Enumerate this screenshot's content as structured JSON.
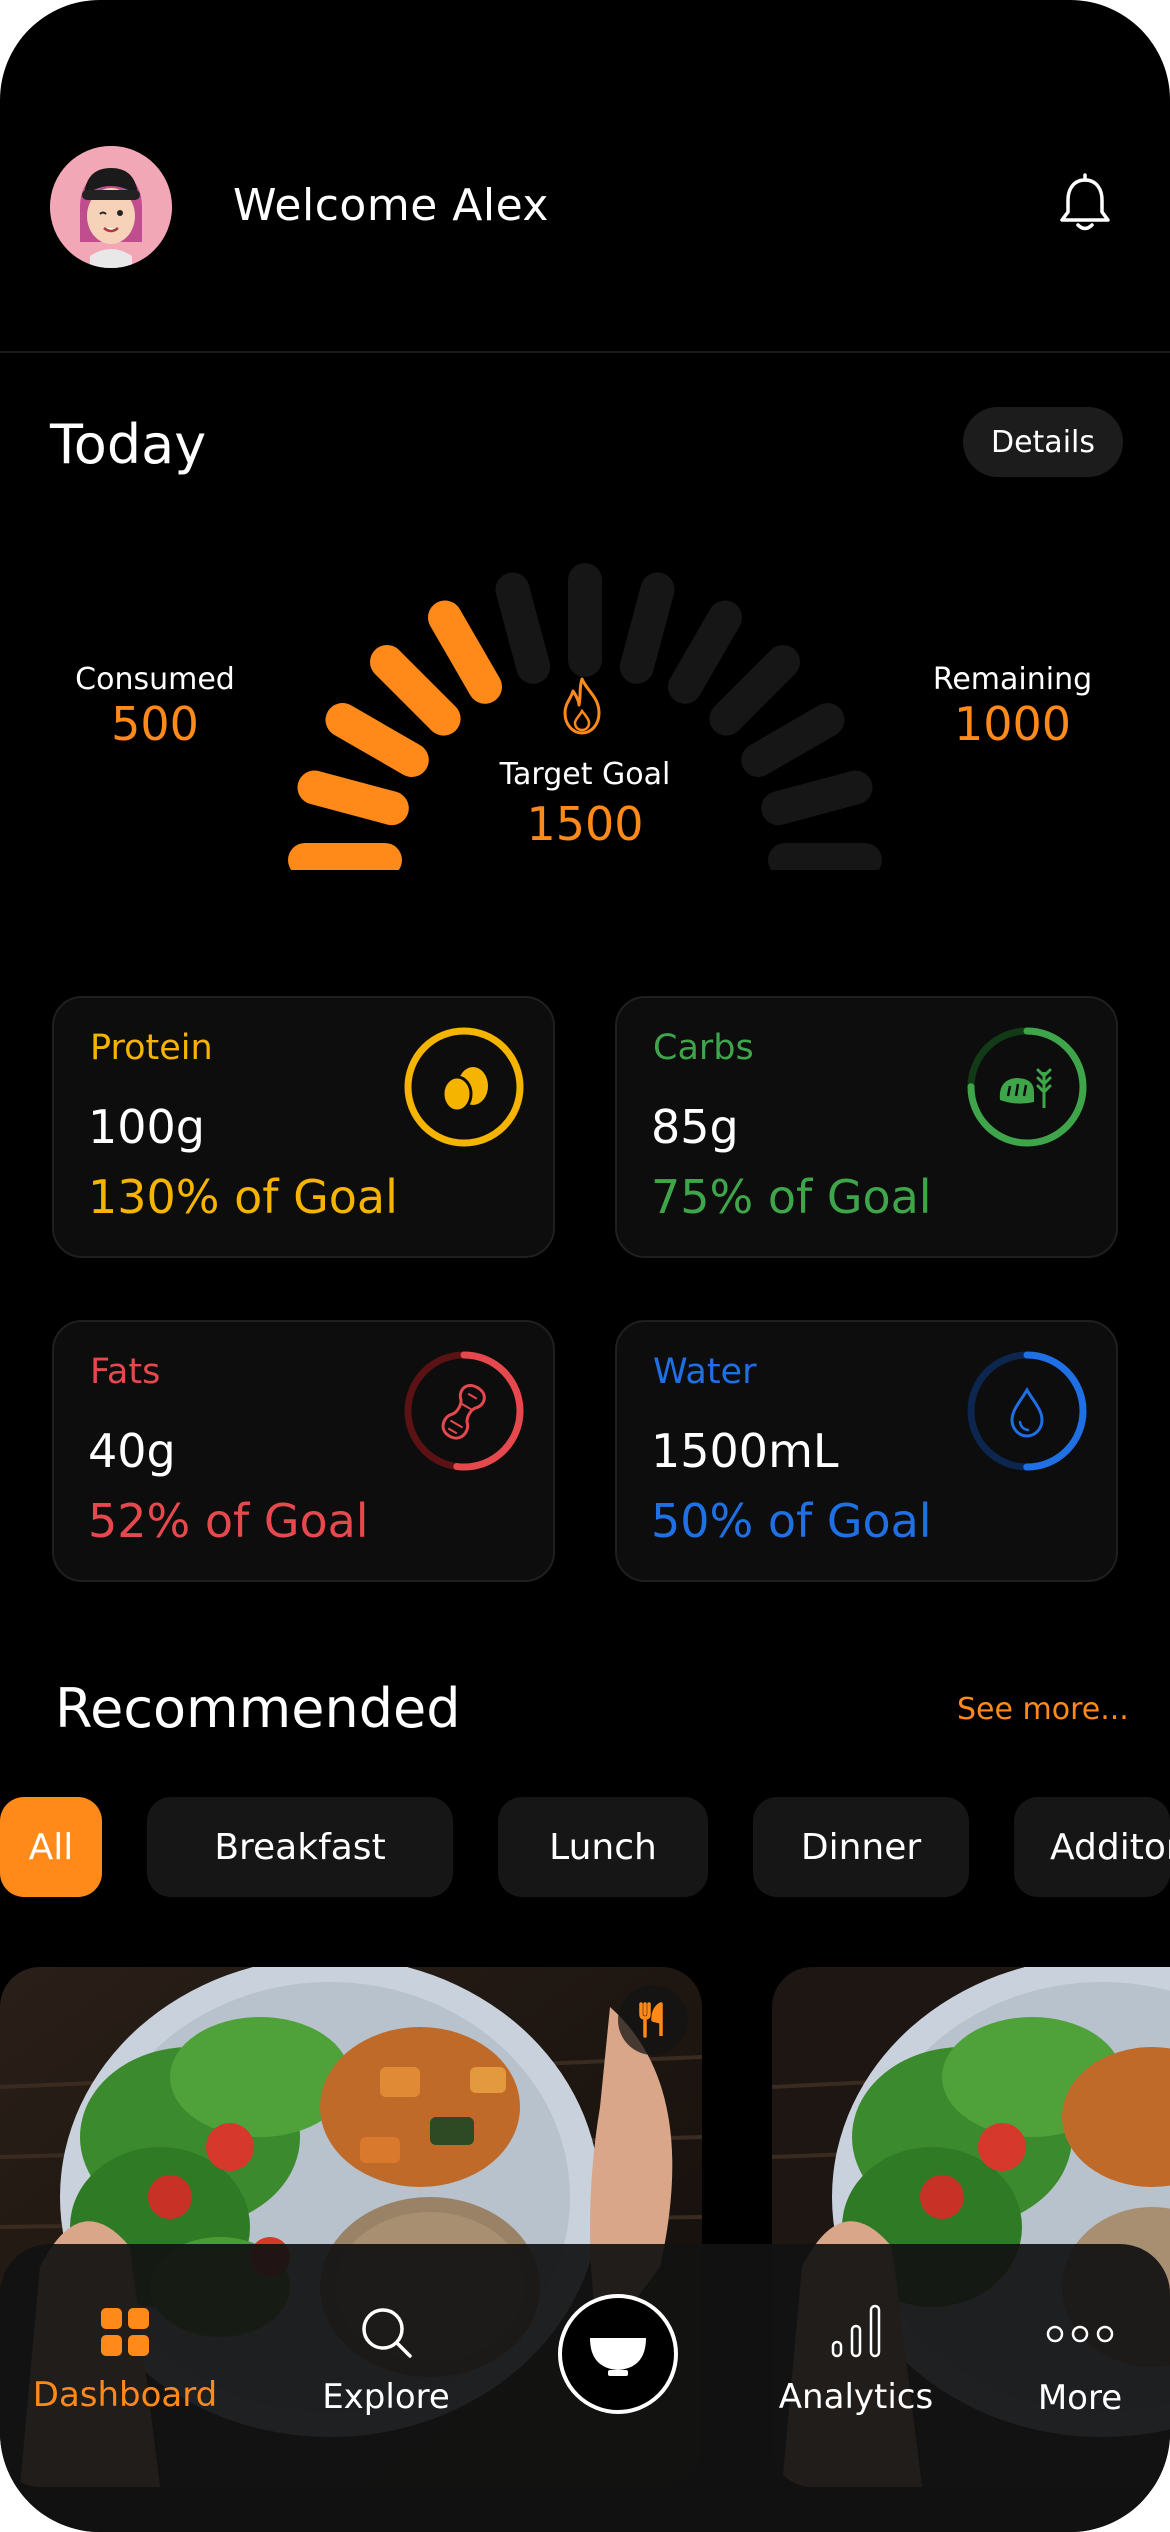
{
  "header": {
    "welcome_text": "Welcome Alex"
  },
  "today": {
    "title": "Today",
    "details_label": "Details",
    "consumed_label": "Consumed",
    "consumed_value": "500",
    "remaining_label": "Remaining",
    "remaining_value": "1000",
    "target_label": "Target Goal",
    "target_value": "1500",
    "progress_fraction": 0.33
  },
  "macros": [
    {
      "name": "Protein",
      "amount": "100g",
      "pct": "130% of Goal",
      "color": "#f5b400",
      "icon": "egg-icon",
      "fill": 1.0
    },
    {
      "name": "Carbs",
      "amount": "85g",
      "pct": "75% of Goal",
      "color": "#3fa54a",
      "icon": "bread-icon",
      "fill": 0.75
    },
    {
      "name": "Fats",
      "amount": "40g",
      "pct": "52% of Goal",
      "color": "#e5484d",
      "icon": "peanut-icon",
      "fill": 0.52
    },
    {
      "name": "Water",
      "amount": "1500mL",
      "pct": "50% of Goal",
      "color": "#1f6fe5",
      "icon": "water-drop-icon",
      "fill": 0.5
    }
  ],
  "recommended": {
    "title": "Recommended",
    "see_more": "See more...",
    "chips": [
      "All",
      "Breakfast",
      "Lunch",
      "Dinner",
      "Additonal"
    ]
  },
  "nav": {
    "dashboard": "Dashboard",
    "explore": "Explore",
    "analytics": "Analytics",
    "more": "More"
  },
  "colors": {
    "accent": "#ff8a1a",
    "background": "#000000"
  }
}
